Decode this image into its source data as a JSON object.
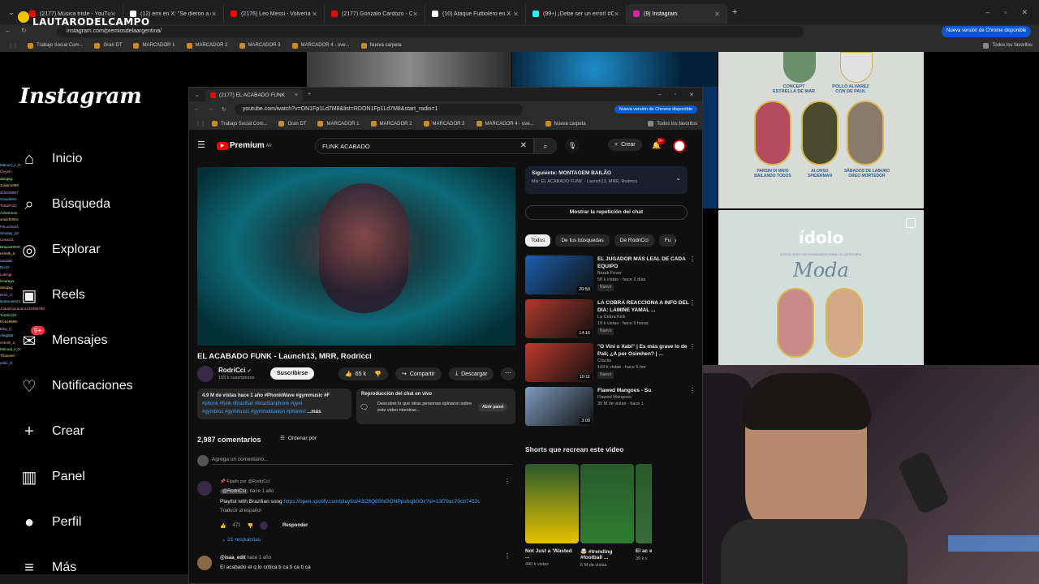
{
  "outer_browser": {
    "tabs": [
      {
        "label": "(2177) Música triste - YouTube",
        "color": "#ff0000",
        "active": false
      },
      {
        "label": "(12) emi en X: \"Se dieron a con\"",
        "color": "#ffffff",
        "active": false
      },
      {
        "label": "(2176) Leo Messi - Volvería a B",
        "color": "#ff0000",
        "active": false
      },
      {
        "label": "(2177) Gonzalo Cardozo - CAR",
        "color": "#ff0000",
        "active": false
      },
      {
        "label": "(10) Ataque Futbolero en X",
        "color": "#ffffff",
        "active": false
      },
      {
        "label": "(99+) ¡Debe ser un error! #CEF",
        "color": "#25f4ee",
        "active": false
      },
      {
        "label": "(9) Instagram",
        "color": "#d6249f",
        "active": true
      }
    ],
    "url": "instagram.com/premiosdelaargentina/",
    "update_button": "Nueva versión de Chrome disponible",
    "bookmarks": [
      "Trabajo Social Com...",
      "Gran DT",
      "MARCADOR 1",
      "MARCADOR 2",
      "MARCADOR 3",
      "MARCADOR 4 - ove...",
      "Nueva carpeta"
    ],
    "all_bookmarks": "Todos los favoritos"
  },
  "overlay_logo": "LAUTARODELCAMPO",
  "instagram": {
    "logo": "Instagram",
    "nav": [
      {
        "label": "Inicio",
        "icon": "home-icon"
      },
      {
        "label": "Búsqueda",
        "icon": "search-icon"
      },
      {
        "label": "Explorar",
        "icon": "compass-icon"
      },
      {
        "label": "Reels",
        "icon": "reels-icon"
      },
      {
        "label": "Mensajes",
        "icon": "messenger-icon",
        "badge": "9+"
      },
      {
        "label": "Notificaciones",
        "icon": "heart-icon"
      },
      {
        "label": "Crear",
        "icon": "plus-icon"
      },
      {
        "label": "Panel",
        "icon": "chart-icon"
      },
      {
        "label": "Perfil",
        "icon": "avatar-icon"
      },
      {
        "label": "Más",
        "icon": "menu-icon"
      }
    ],
    "posts": {
      "top_left_caption1": "CONCEPT\nESTRELLA DE MAR",
      "top_left_caption2": "POLLO ALVAREZ\nCON DE PAUL",
      "captions_row": [
        "PARSIN DI MAIO\nBAILANDO TODOS",
        "ALONSO\nSPIDERMAN",
        "SÁBADOS DE LABURO\nOREO MORTEDOR"
      ],
      "idolo_title": "ídolo",
      "idolo_sub": "ESTOS SON LOS NOMINADOS PARA LA CATEGORÍA",
      "idolo_category": "Moda"
    }
  },
  "chat_lines": [
    "Manuel_x_X:",
    "Cwyoh:",
    "dangag:",
    "Juliian1899:",
    "SUEN0957:",
    "Claudio91:",
    "TomilAr32:",
    "Ackeeman:",
    "xmacf2904:",
    "FeLucho24:",
    "Snoopy_22:",
    "Cesar21:",
    "Brayan0000:",
    "estrelli_a:",
    "uaupall:",
    "Dior2:",
    "Lukingi:",
    "lucaraya:",
    "dangag:",
    "DHC_0:",
    "lautaruiurum:",
    "Joaquinjorquera123456789:",
    "TomilAr32:",
    "Rone9999:",
    "Elay_b:",
    "Alegalar:",
    "estrelli_a:",
    "Manual_x_X:",
    "Thanee0:",
    "yahir_rt:"
  ],
  "youtube_window": {
    "tab_label": "(2177) EL ACABADO FUNK",
    "url": "youtube.com/watch?v=ON1Fp1Ld7M8&list=RDON1Fp1Ld7M8&start_radio=1",
    "update_button": "Nueva versión de Chrome disponible",
    "bookmarks": [
      "Trabajo Social Com...",
      "Gran DT",
      "MARCADOR 1",
      "MARCADOR 2",
      "MARCADOR 3",
      "MARCADOR 4 - ove...",
      "Nueva carpeta"
    ],
    "all_bookmarks": "Todos los favoritos",
    "logo": "Premium",
    "logo_country": "AR",
    "search_value": "FUNK ACABADO",
    "create_label": "Crear",
    "notif_count": "9+",
    "video": {
      "title": "EL ACABADO FUNK - Launch13, MRR, Rodricci",
      "channel": "RodriCci",
      "subs": "165 k suscriptores",
      "subscribe": "Suscribirse",
      "likes": "65 k",
      "share": "Compartir",
      "download": "Descargar",
      "views_line": "4.9 M de vistas  hace 1 año  #PhonkWave #gymmusic #F",
      "tags_line1": "#phonk #funk #brazilian #brazilianphonk #gym",
      "tags_line2": "#gymbros #gymmusic #gymmotivation #phonkvi",
      "more": "...más",
      "chat_replay_title": "Reproducción del chat en vivo",
      "chat_replay_desc": "Descubre lo que otras personas opinaron sobre este video mientras...",
      "open_panel": "Abrir panel"
    },
    "comments": {
      "count": "2,987 comentarios",
      "sort": "Ordenar por",
      "add_placeholder": "Agrega un comentario...",
      "pinned": "Fijado por @RodriCci",
      "c1_author": "@RodriCci",
      "c1_time": "hace 1 año",
      "c1_text": "Playlist with Brazilian song",
      "c1_link": "https://open.spotify.com/playlist/43l28Q8SNGONPpshqjk0Oz?si=13f79ac70cb7452c",
      "translate": "Traducir al español",
      "c1_likes": "471",
      "reply": "Responder",
      "replies": "21 respuestas",
      "c2_author": "@isaa_edit",
      "c2_time": "hace 1 año",
      "c2_text": "El acabado el q lo critica ti ca ti ca ti ca"
    },
    "playlist": {
      "next": "Siguiente: MONTAGEM BAILÃO",
      "mix": "Mix: EL ACABADO FUNK - Launch13, MRR, Rodricci"
    },
    "show_chat_replay": "Mostrar la repetición del chat",
    "chips": [
      "Todos",
      "De tus búsquedas",
      "De RodriCci",
      "Fu"
    ],
    "recs": [
      {
        "title": "EL JUGADOR MÁS LEAL DE CADA EQUIPO",
        "channel": "Barak Fever",
        "meta": "58 k vistas · hace 2 días",
        "badge": "Nuevo",
        "dur": "20:59",
        "color": "#1b5fae"
      },
      {
        "title": "LA COBRA REACCIONA A INFO DEL DIA: LAMINE YAMAL ...",
        "channel": "La Cobra Kick",
        "meta": "19 k vistas · hace 9 horas",
        "badge": "Nuevo",
        "dur": "14:16",
        "color": "#b03a2e"
      },
      {
        "title": "\"O Vini o Xabi\" | Es más grave lo de Pali; ¿A por Osimhen? | ...",
        "channel": "Cracks",
        "meta": "143 k vistas · hace 5 hor",
        "badge": "Nuevo",
        "dur": "10:11",
        "color": "#c0392b"
      },
      {
        "title": "Flawed Mangoes - Su",
        "channel": "Flawed Mangoes",
        "meta": "30 M de vistas · hace 1",
        "badge": "",
        "dur": "3:09",
        "color": "#7f9bbf"
      }
    ],
    "shorts_title": "Shorts que recrean este video",
    "shorts": [
      {
        "title": "Not Just a 'Wasted ...",
        "views": "440 k vistas",
        "color": "#e6c200"
      },
      {
        "title": "🤯 #trending #football ...",
        "views": "5 M de vistas",
        "color": "#2e7d32"
      },
      {
        "title": "El ac el ...",
        "views": "39 k v",
        "color": "#3a6b3a"
      }
    ]
  }
}
